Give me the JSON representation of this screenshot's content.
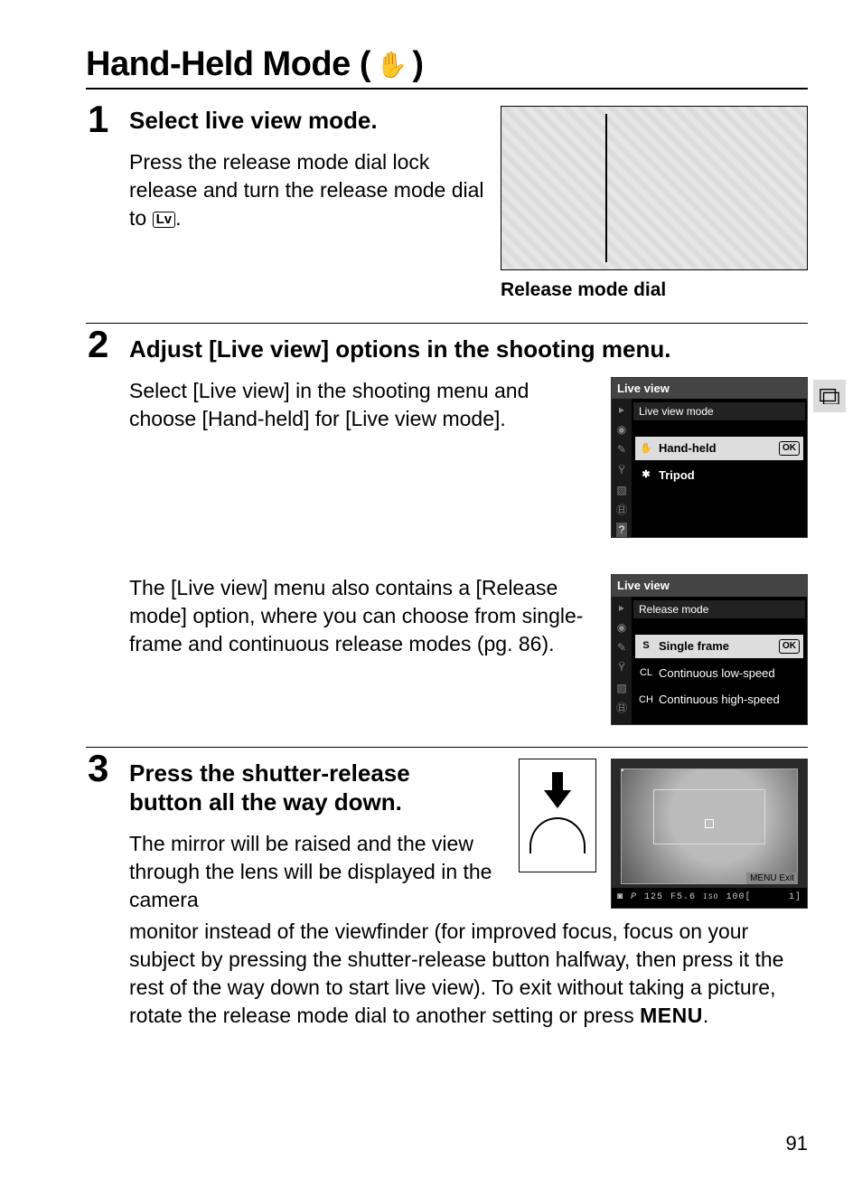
{
  "title_prefix": "Hand-Held Mode (",
  "title_suffix": ")",
  "hand_icon": "✋",
  "steps": {
    "s1": {
      "num": "1",
      "heading": "Select live view mode.",
      "body_a": "Press the release mode dial lock release and turn the release mode dial to ",
      "lv_label": "Lv",
      "body_b": ".",
      "caption": "Release mode dial"
    },
    "s2": {
      "num": "2",
      "heading": "Adjust [Live view] options in the shooting menu.",
      "para1": "Select [Live view] in the shooting menu and choose [Hand-held] for [Live view mode].",
      "para2": "The [Live view] menu also contains a [Release mode] option, where you can choose from single-frame and continuous release modes (pg. 86).",
      "menu1": {
        "title": "Live view",
        "subtitle": "Live view mode",
        "item_sel_icon": "✋",
        "item_sel": "Hand-held",
        "ok": "OK",
        "item2_icon": "✱",
        "item2": "Tripod"
      },
      "menu2": {
        "title": "Live view",
        "subtitle": "Release mode",
        "row1_lead": "S",
        "row1": "Single frame",
        "ok": "OK",
        "row2_lead": "CL",
        "row2": "Continuous low-speed",
        "row3_lead": "CH",
        "row3": "Continuous high-speed"
      }
    },
    "s3": {
      "num": "3",
      "heading": "Press the shutter-release button all the way down.",
      "para_a": "The mirror will be raised and the view through the lens will be displayed in the camera",
      "para_b": "monitor instead of the viewfinder (for improved focus, focus on your subject by pressing the shutter-release button halfway, then press it the rest of the way down to start live view).  To exit without taking a picture, rotate the release mode dial to another setting or press ",
      "menu_word": "MENU",
      "para_c": ".",
      "lv": {
        "exit": "MENU Exit",
        "bar_p": "P",
        "bar_ss": "125",
        "bar_ap": "F5.6",
        "bar_iso_lbl": "ISO",
        "bar_iso": "100[",
        "bar_end": "1]"
      }
    }
  },
  "page_number": "91"
}
